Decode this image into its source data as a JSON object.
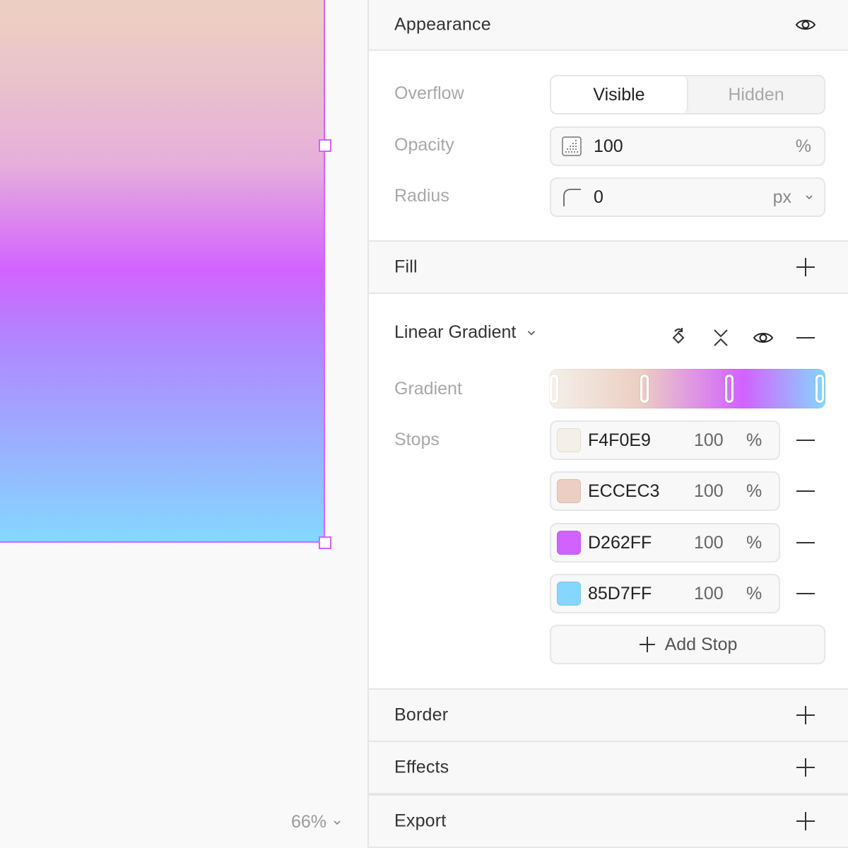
{
  "canvas": {
    "zoom_label": "66%"
  },
  "appearance": {
    "title": "Appearance",
    "overflow_label": "Overflow",
    "overflow_options": [
      "Visible",
      "Hidden"
    ],
    "overflow_selected": "Visible",
    "opacity_label": "Opacity",
    "opacity_value": "100",
    "opacity_unit": "%",
    "radius_label": "Radius",
    "radius_value": "0",
    "radius_unit": "px"
  },
  "fill": {
    "title": "Fill",
    "type_label": "Linear Gradient",
    "gradient_label": "Gradient",
    "stops_label": "Stops",
    "stops": [
      {
        "hex": "F4F0E9",
        "opacity": "100",
        "unit": "%",
        "color": "#F4F0E9"
      },
      {
        "hex": "ECCEC3",
        "opacity": "100",
        "unit": "%",
        "color": "#ECCEC3"
      },
      {
        "hex": "D262FF",
        "opacity": "100",
        "unit": "%",
        "color": "#D262FF"
      },
      {
        "hex": "85D7FF",
        "opacity": "100",
        "unit": "%",
        "color": "#85D7FF"
      }
    ],
    "add_stop_label": "Add Stop"
  },
  "border": {
    "title": "Border"
  },
  "effects": {
    "title": "Effects"
  },
  "export": {
    "title": "Export"
  },
  "icons": [
    "eye-icon",
    "plus-icon",
    "chevron-down-icon",
    "opacity-icon",
    "radius-icon",
    "rotate-icon",
    "swap-icon",
    "minus-icon"
  ],
  "colors": {
    "accent": "#D262FF",
    "selection": "#D262FF"
  }
}
